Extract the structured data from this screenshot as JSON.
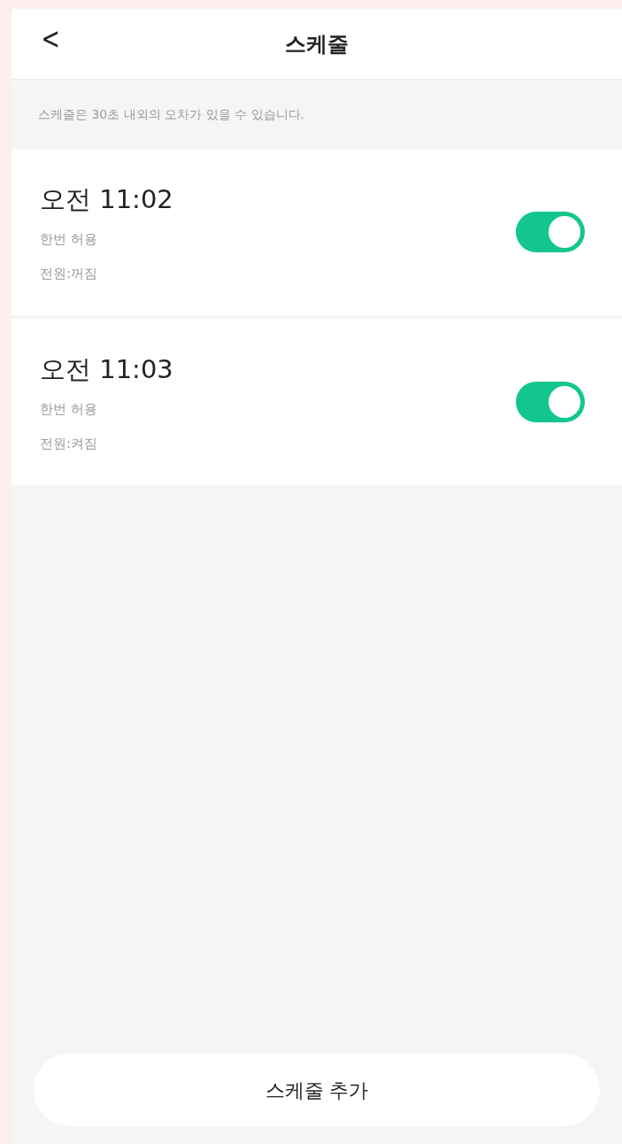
{
  "header": {
    "back": "<",
    "title": "스케줄"
  },
  "notice": "스케줄은 30초 내외의 오차가 있을 수 있습니다.",
  "schedules": [
    {
      "time": "오전 11:02",
      "repeat": "한번 허용",
      "power": "전원:꺼짐",
      "on": true
    },
    {
      "time": "오전 11:03",
      "repeat": "한번 허용",
      "power": "전원:켜짐",
      "on": true
    }
  ],
  "add_button": "스케줄 추가"
}
